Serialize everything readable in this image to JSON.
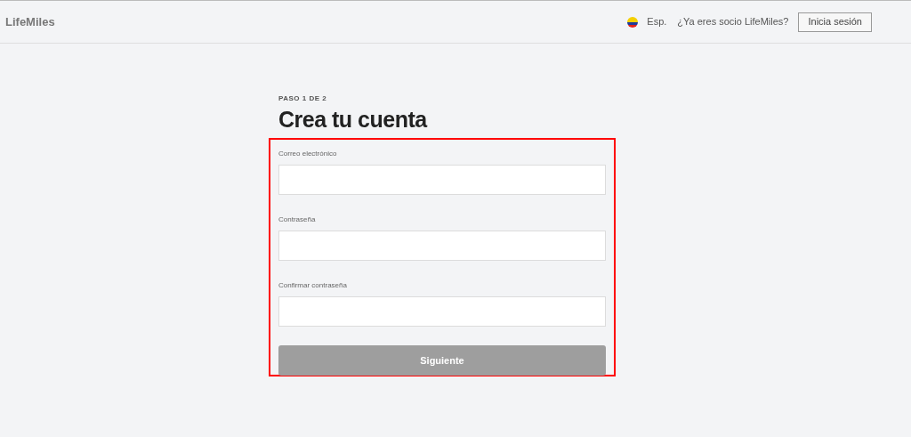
{
  "header": {
    "logo": "LifeMiles",
    "language": "Esp.",
    "member_prompt": "¿Ya eres socio LifeMiles?",
    "login_button": "Inicia sesión"
  },
  "form": {
    "step": "PASO 1 DE 2",
    "title": "Crea tu cuenta",
    "highlighted": true,
    "fields": [
      {
        "label": "Correo electrónico"
      },
      {
        "label": "Contraseña"
      },
      {
        "label": "Confirmar contraseña"
      }
    ],
    "submit": {
      "label": "Siguiente",
      "disabled": true
    }
  }
}
